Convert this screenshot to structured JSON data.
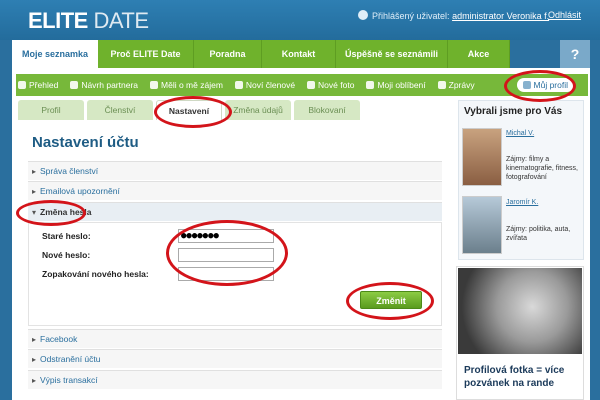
{
  "header": {
    "logo_bold": "ELITE",
    "logo_thin": " DATE",
    "logged_in_label": "Přihlášený uživatel:",
    "username": "administrator Veronika f.",
    "logout": "Odhlásit"
  },
  "main_nav": {
    "items": [
      "Moje seznamka",
      "Proč ELITE Date",
      "Poradna",
      "Kontakt",
      "Úspěšně se seznámili",
      "Akce"
    ],
    "help": "?"
  },
  "sub_nav": {
    "items": [
      "Přehled",
      "Návrh partnera",
      "Měli o mě zájem",
      "Noví členové",
      "Nové foto",
      "Moji oblíbení",
      "Zprávy"
    ],
    "profile": "Můj profil"
  },
  "tabs": [
    "Profil",
    "Členství",
    "Nastavení",
    "Změna údajů",
    "Blokovaní"
  ],
  "page": {
    "title": "Nastavení účtu",
    "sections": [
      "Správa členství",
      "Emailová upozornění",
      "Změna hesla",
      "Facebook",
      "Odstranění účtu",
      "Výpis transakcí"
    ]
  },
  "form": {
    "old_password_label": "Staré heslo:",
    "old_password_value": "●●●●●●●",
    "new_password_label": "Nové heslo:",
    "repeat_password_label": "Zopakování nového hesla:",
    "submit": "Změnit"
  },
  "sidebar": {
    "title": "Vybrali jsme pro Vás",
    "members": [
      {
        "name": "Michal V.",
        "desc": "Zájmy: filmy a kinematografie, fitness, fotografování"
      },
      {
        "name": "Jaromír K.",
        "desc": "Zájmy: politika, auta, zvířata"
      }
    ],
    "promo_text": "Profilová fotka = více pozvánek na rande"
  }
}
